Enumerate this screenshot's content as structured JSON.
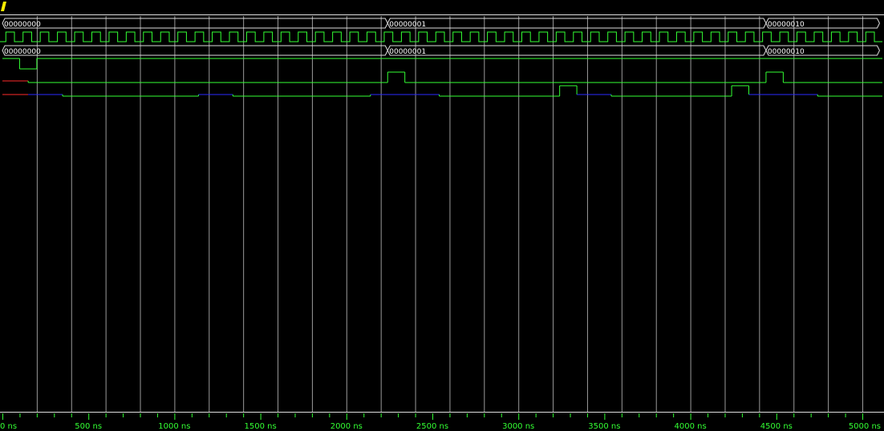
{
  "timeline": {
    "unit": "ns",
    "start": 0,
    "end": 5000,
    "major_step": 500,
    "minor_step": 100,
    "tick_labels": [
      "0 ns",
      "500 ns",
      "1000 ns",
      "1500 ns",
      "2000 ns",
      "2500 ns",
      "3000 ns",
      "3500 ns",
      "4000 ns",
      "4500 ns",
      "5000 ns"
    ],
    "grid_step": 200
  },
  "colors": {
    "background": "#000000",
    "grid": "#9a9a9a",
    "signal": "#33ff33",
    "bus_border": "#dddddd",
    "undefined": "#ff2a2a",
    "highz": "#2a2aff",
    "cursor": "#ffee00",
    "label_text": "#ffffff"
  },
  "signals": [
    {
      "kind": "bus",
      "segments": [
        {
          "start": 0,
          "end": 2240,
          "value": "00000000"
        },
        {
          "start": 2240,
          "end": 4440,
          "value": "00000001"
        },
        {
          "start": 4440,
          "end": 5100,
          "value": "00000010"
        }
      ]
    },
    {
      "kind": "clock",
      "period": 100,
      "offset": 20
    },
    {
      "kind": "bus",
      "segments": [
        {
          "start": 0,
          "end": 2240,
          "value": "00000000"
        },
        {
          "start": 2240,
          "end": 4440,
          "value": "00000001"
        },
        {
          "start": 4440,
          "end": 5100,
          "value": "00000010"
        }
      ]
    },
    {
      "kind": "bit",
      "initial": 1,
      "edges": [
        [
          100,
          0
        ],
        [
          200,
          1
        ]
      ]
    },
    {
      "kind": "bit",
      "initial": "x",
      "undefined_until": 150,
      "edges": [
        [
          150,
          0
        ],
        [
          2240,
          1
        ],
        [
          2340,
          0
        ],
        [
          4440,
          1
        ],
        [
          4540,
          0
        ]
      ]
    },
    {
      "kind": "bit",
      "initial": "x",
      "undefined_until": 150,
      "edges": [
        [
          150,
          "z"
        ],
        [
          350,
          0
        ],
        [
          1140,
          "z"
        ],
        [
          1340,
          0
        ],
        [
          2140,
          "z"
        ],
        [
          2540,
          0
        ],
        [
          3240,
          1
        ],
        [
          3340,
          "z"
        ],
        [
          3540,
          0
        ],
        [
          4240,
          1
        ],
        [
          4340,
          "z"
        ],
        [
          4740,
          0
        ]
      ]
    }
  ]
}
